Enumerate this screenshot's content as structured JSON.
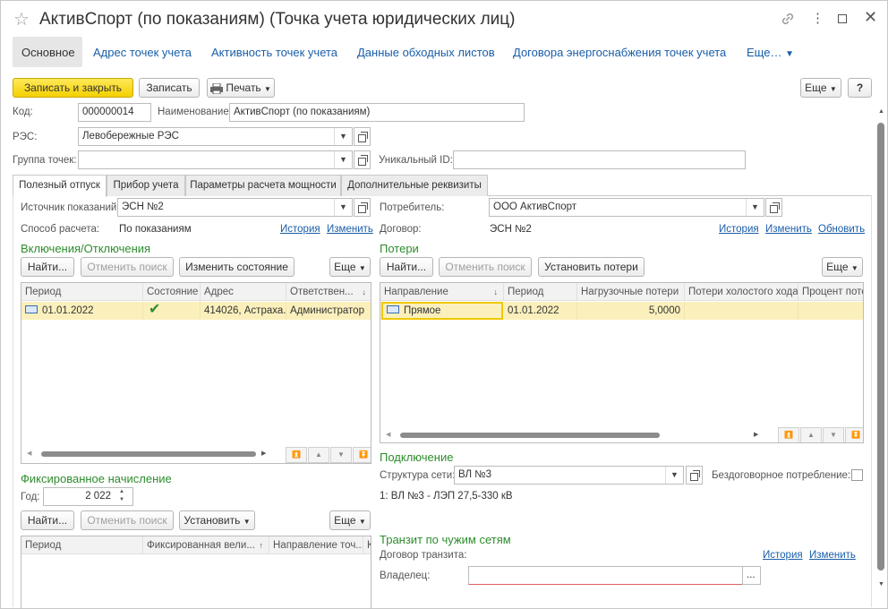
{
  "window": {
    "title": "АктивСпорт (по показаниям) (Точка учета юридических лиц)"
  },
  "nav": {
    "tabs": [
      "Основное",
      "Адрес точек учета",
      "Активность точек учета",
      "Данные обходных листов",
      "Договора энергоснабжения точек учета",
      "Еще…"
    ]
  },
  "toolbar": {
    "save_close": "Записать и закрыть",
    "save": "Записать",
    "print": "Печать",
    "more": "Еще",
    "help": "?"
  },
  "fields": {
    "kod_label": "Код:",
    "kod_value": "000000014",
    "name_label": "Наименование:",
    "name_value": "АктивСпорт (по показаниям)",
    "res_label": "РЭС:",
    "res_value": "Левобережные РЭС",
    "group_label": "Группа точек:",
    "group_value": "",
    "uid_label": "Уникальный ID:",
    "uid_value": ""
  },
  "page_tabs": [
    "Полезный отпуск",
    "Прибор учета",
    "Параметры расчета мощности",
    "Дополнительные реквизиты"
  ],
  "left": {
    "source_label": "Источник показаний:",
    "source_value": "ЭСН №2",
    "method_label": "Способ расчета:",
    "method_value": "По показаниям",
    "history": "История",
    "change": "Изменить",
    "switch_title": "Включения/Отключения",
    "find": "Найти...",
    "cancel_search": "Отменить поиск",
    "change_state": "Изменить состояние",
    "more": "Еще",
    "switch_columns": [
      "Период",
      "Состояние",
      "Адрес",
      "Ответствен..."
    ],
    "switch_rows": [
      {
        "period": "01.01.2022",
        "state": "✔",
        "address": "414026, Астраха...",
        "resp": "Администратор"
      }
    ],
    "fixed_title": "Фиксированное начисление",
    "year_label": "Год:",
    "year_value": "2 022",
    "set": "Установить",
    "fixed_columns": [
      "Период",
      "Фиксированная вели...",
      "Направление точ...",
      "К"
    ]
  },
  "right": {
    "consumer_label": "Потребитель:",
    "consumer_value": "ООО АктивСпорт",
    "contract_label": "Договор:",
    "contract_value": "ЭСН №2",
    "history": "История",
    "change": "Изменить",
    "update": "Обновить",
    "losses_title": "Потери",
    "find": "Найти...",
    "cancel_search": "Отменить поиск",
    "set_losses": "Установить потери",
    "more": "Еще",
    "loss_columns": [
      "Направление",
      "Период",
      "Нагрузочные потери",
      "Потери холостого хода",
      "Процент поте"
    ],
    "loss_rows": [
      {
        "direction": "Прямое",
        "period": "01.01.2022",
        "load": "5,0000",
        "idle": "",
        "percent": ""
      }
    ],
    "connection_title": "Подключение",
    "network_label": "Структура сети:",
    "network_value": "ВЛ №3",
    "noncontract_label": "Бездоговорное потребление:",
    "network_path": "1: ВЛ №3 - ЛЭП 27,5-330 кВ",
    "transit_title": "Транзит по чужим сетям",
    "transit_contract_label": "Договор транзита:",
    "owner_label": "Владелец:",
    "owner_value": ""
  }
}
